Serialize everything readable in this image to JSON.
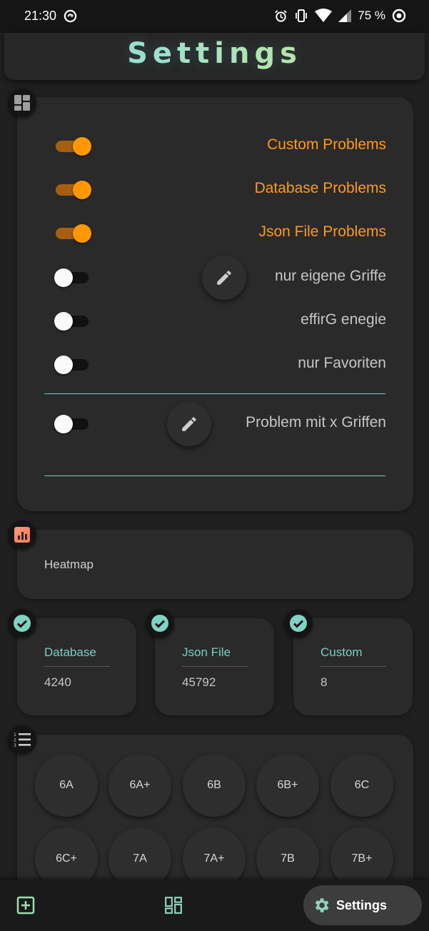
{
  "status_bar": {
    "time": "21:30",
    "battery": "75 %"
  },
  "header": {
    "title": "Settings"
  },
  "filters": {
    "icon": "dashboard-icon",
    "toggles": [
      {
        "label": "Custom Problems",
        "on": true
      },
      {
        "label": "Database Problems",
        "on": true
      },
      {
        "label": "Json File Problems",
        "on": true
      },
      {
        "label": "nur eigene Griffe",
        "on": false
      },
      {
        "label": "effirG enegie",
        "on": false
      },
      {
        "label": "nur Favoriten",
        "on": false
      }
    ],
    "holds": {
      "label": "Problem mit x Griffen",
      "on": false
    }
  },
  "heatmap": {
    "label": "Heatmap",
    "icon": "bar-chart-icon"
  },
  "stats": [
    {
      "name": "Database",
      "value": "4240"
    },
    {
      "name": "Json File",
      "value": "45792"
    },
    {
      "name": "Custom",
      "value": "8"
    }
  ],
  "grades": [
    "6A",
    "6A+",
    "6B",
    "6B+",
    "6C",
    "6C+",
    "7A",
    "7A+",
    "7B",
    "7B+"
  ],
  "nav": {
    "active_label": "Settings"
  },
  "colors": {
    "accent": "#ff9800",
    "teal": "#79cfc4",
    "background": "#1f1f1f"
  }
}
